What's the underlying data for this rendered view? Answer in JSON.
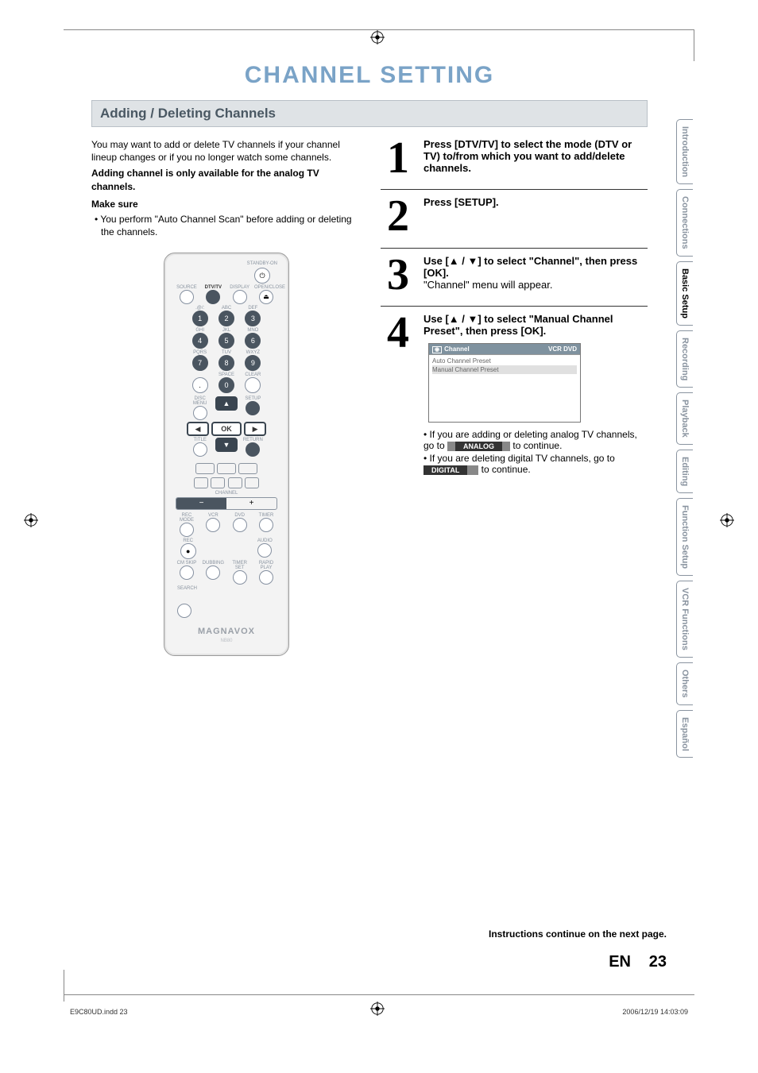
{
  "page": {
    "title": "CHANNEL SETTING",
    "section": "Adding / Deleting Channels",
    "lang": "EN",
    "number": "23",
    "continue": "Instructions continue on the next page.",
    "file_meta_left": "E9C80UD.indd   23",
    "file_meta_right": "2006/12/19   14:03:09"
  },
  "intro": {
    "p1": "You may want to add or delete TV channels if your channel lineup changes or if you no longer watch some channels.",
    "p2": "Adding channel is only available for the analog TV channels.",
    "p3": "Make sure",
    "bullet1": "• You perform \"Auto Channel Scan\" before adding or deleting the channels."
  },
  "steps": {
    "s1": {
      "num": "1",
      "text": "Press [DTV/TV] to select the mode (DTV or TV) to/from which you want to add/delete channels."
    },
    "s2": {
      "num": "2",
      "text": "Press [SETUP]."
    },
    "s3": {
      "num": "3",
      "line1": "Use [▲ / ▼] to select \"Channel\", then press [OK].",
      "line2": "\"Channel\" menu will appear."
    },
    "s4": {
      "num": "4",
      "line1": "Use [▲ / ▼] to select \"Manual Channel Preset\", then press [OK].",
      "osd": {
        "title": "Channel",
        "mode": "VCR  DVD",
        "item1": "Auto Channel Preset",
        "item2": "Manual Channel Preset"
      },
      "note1a": "• If you are adding or deleting analog TV channels, go to ",
      "note1b": " to continue.",
      "note2a": "• If you are deleting digital TV channels, go to ",
      "note2b": " to continue.",
      "pill_analog": "ANALOG",
      "pill_digital": "DIGITAL"
    }
  },
  "remote": {
    "standby": "STANDBY-ON",
    "r1": {
      "source": "SOURCE",
      "dtv": "DTV/TV",
      "display": "DISPLAY",
      "open": "OPEN/CLOSE"
    },
    "keypad": {
      "labels": [
        ".@/:",
        "ABC",
        "DEF",
        "GHI",
        "JKL",
        "MNO",
        "PQRS",
        "TUV",
        "WXYZ",
        "",
        "SPACE",
        "CLEAR"
      ],
      "nums": [
        "1",
        "2",
        "3",
        "4",
        "5",
        "6",
        "7",
        "8",
        "9",
        ".",
        "0",
        ""
      ]
    },
    "discmenu": "DISC MENU",
    "setup": "SETUP",
    "ok": "OK",
    "title": "TITLE",
    "return": "RETURN",
    "channel": "CHANNEL",
    "minus": "−",
    "plus": "+",
    "recmode": "REC MODE",
    "vcr": "VCR",
    "dvd": "DVD",
    "timer": "TIMER",
    "rec": "REC",
    "audio": "AUDIO",
    "cmskip": "CM SKIP",
    "dubbing": "DUBBING",
    "timerset": "TIMER\nSET",
    "rapid": "RAPID PLAY",
    "search": "SEARCH",
    "brand": "MAGNAVOX",
    "model": "NB80"
  },
  "tabs": {
    "t1": "Introduction",
    "t2": "Connections",
    "t3": "Basic Setup",
    "t4": "Recording",
    "t5": "Playback",
    "t6": "Editing",
    "t7": "Function Setup",
    "t8": "VCR Functions",
    "t9": "Others",
    "t10": "Español"
  }
}
